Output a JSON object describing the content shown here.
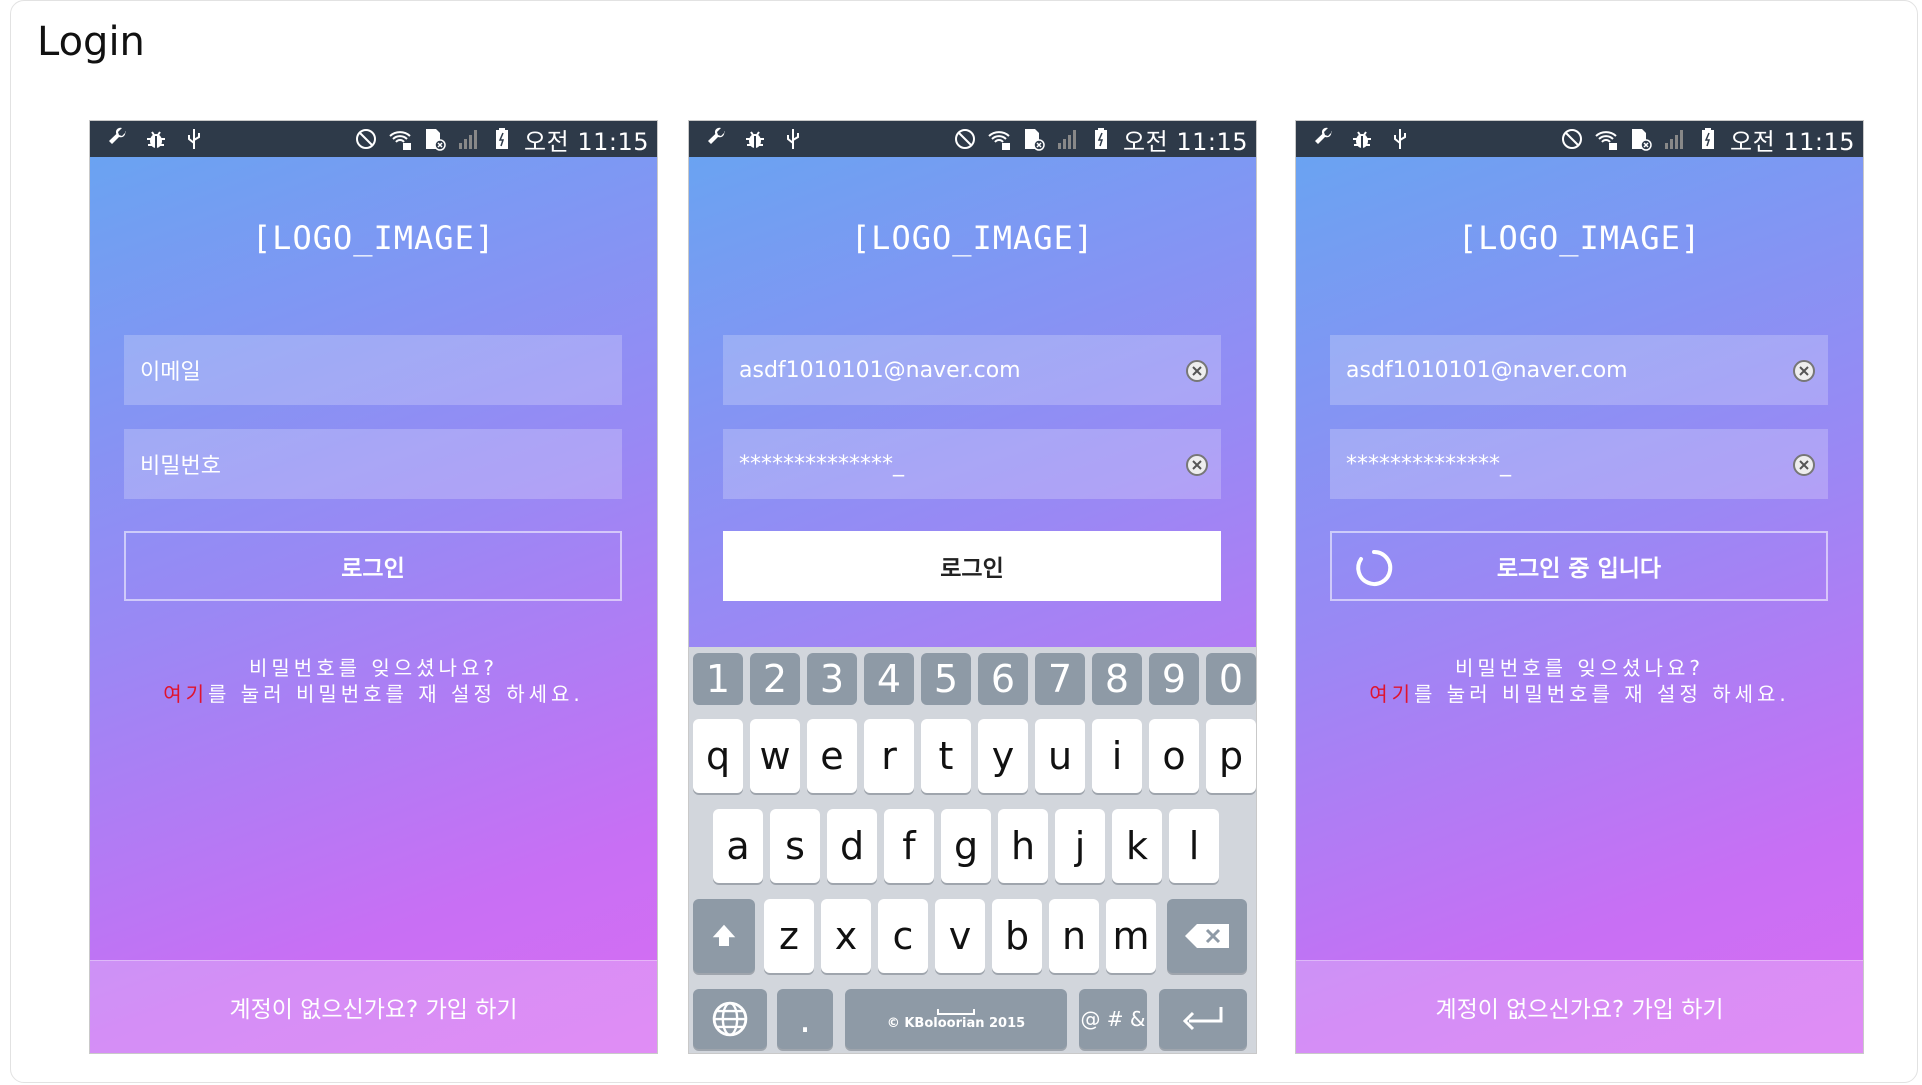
{
  "page": {
    "title": "Login"
  },
  "status_bar": {
    "time": "오전 11:15"
  },
  "logo": "[LOGO_IMAGE]",
  "screen1": {
    "email_placeholder": "이메일",
    "password_placeholder": "비밀번호",
    "login_button": "로그인",
    "forgot_line1": "비밀번호를 잊으셨나요?",
    "forgot_here": "여기",
    "forgot_rest": "를 눌러 비밀번호를 재 설정 하세요.",
    "signup": "계정이 없으신가요? 가입 하기"
  },
  "screen2": {
    "email_value": "asdf1010101@naver.com",
    "password_value": "**************_",
    "login_button": "로그인",
    "keyboard": {
      "numbers": [
        "1",
        "2",
        "3",
        "4",
        "5",
        "6",
        "7",
        "8",
        "9",
        "0"
      ],
      "row1": [
        "q",
        "w",
        "e",
        "r",
        "t",
        "y",
        "u",
        "i",
        "o",
        "p"
      ],
      "row2": [
        "a",
        "s",
        "d",
        "f",
        "g",
        "h",
        "j",
        "k",
        "l"
      ],
      "row3": [
        "z",
        "x",
        "c",
        "v",
        "b",
        "n",
        "m"
      ],
      "period": ".",
      "space_label": "© KBoloorian 2015",
      "symbols_label": "@ # &"
    }
  },
  "screen3": {
    "email_value": "asdf1010101@naver.com",
    "password_value": "**************_",
    "login_button": "로그인 중 입니다",
    "forgot_line1": "비밀번호를 잊으셨나요?",
    "forgot_here": "여기",
    "forgot_rest": "를 눌러 비밀번호를 재 설정 하세요.",
    "signup": "계정이 없으신가요? 가입 하기"
  },
  "colors": {
    "status_bar": "#2e3a49",
    "accent_red": "#e0132d",
    "keyboard_bg": "#d2d6dc"
  }
}
